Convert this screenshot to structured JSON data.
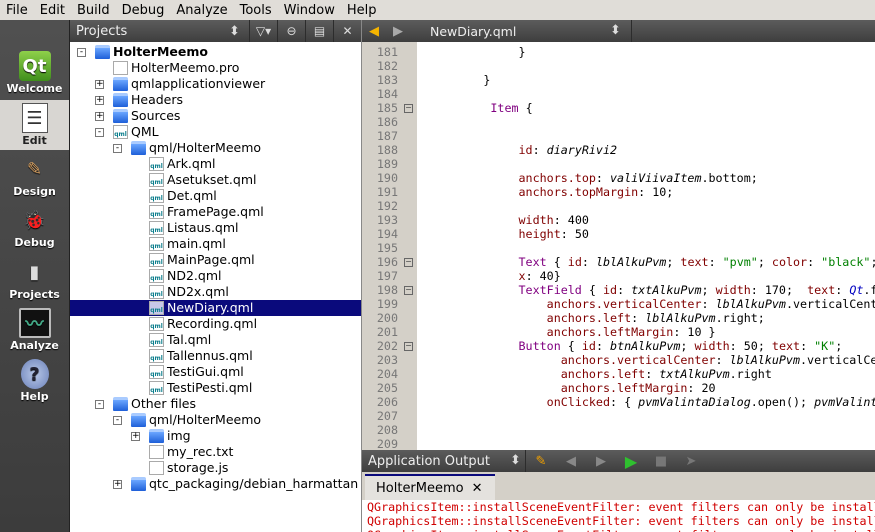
{
  "menu": [
    "File",
    "Edit",
    "Build",
    "Debug",
    "Analyze",
    "Tools",
    "Window",
    "Help"
  ],
  "modes": [
    {
      "label": "Welcome",
      "icon": "qt-logo-icon"
    },
    {
      "label": "Edit",
      "icon": "edit-document-icon",
      "active": true
    },
    {
      "label": "Design",
      "icon": "design-brush-icon"
    },
    {
      "label": "Debug",
      "icon": "debug-bug-icon"
    },
    {
      "label": "Projects",
      "icon": "projects-folder-icon"
    },
    {
      "label": "Analyze",
      "icon": "analyze-oscilloscope-icon"
    },
    {
      "label": "Help",
      "icon": "help-icon"
    }
  ],
  "projects": {
    "title": "Projects",
    "tree": [
      {
        "label": "HolterMeemo",
        "level": 0,
        "exp": "-",
        "icon": "folder-qt",
        "bold": true
      },
      {
        "label": "HolterMeemo.pro",
        "level": 1,
        "icon": "file-qt"
      },
      {
        "label": "qmlapplicationviewer",
        "level": 1,
        "exp": "+",
        "icon": "folder-qt"
      },
      {
        "label": "Headers",
        "level": 1,
        "exp": "+",
        "icon": "folder-h"
      },
      {
        "label": "Sources",
        "level": 1,
        "exp": "+",
        "icon": "folder-cpp"
      },
      {
        "label": "QML",
        "level": 1,
        "exp": "-",
        "icon": "qml"
      },
      {
        "label": "qml/HolterMeemo",
        "level": 2,
        "exp": "-",
        "icon": "folder"
      },
      {
        "label": "Ark.qml",
        "level": 3,
        "icon": "qml"
      },
      {
        "label": "Asetukset.qml",
        "level": 3,
        "icon": "qml"
      },
      {
        "label": "Det.qml",
        "level": 3,
        "icon": "qml"
      },
      {
        "label": "FramePage.qml",
        "level": 3,
        "icon": "qml"
      },
      {
        "label": "Listaus.qml",
        "level": 3,
        "icon": "qml"
      },
      {
        "label": "main.qml",
        "level": 3,
        "icon": "qml"
      },
      {
        "label": "MainPage.qml",
        "level": 3,
        "icon": "qml"
      },
      {
        "label": "ND2.qml",
        "level": 3,
        "icon": "qml"
      },
      {
        "label": "ND2x.qml",
        "level": 3,
        "icon": "qml"
      },
      {
        "label": "NewDiary.qml",
        "level": 3,
        "icon": "qml",
        "selected": true
      },
      {
        "label": "Recording.qml",
        "level": 3,
        "icon": "qml"
      },
      {
        "label": "Tal.qml",
        "level": 3,
        "icon": "qml"
      },
      {
        "label": "Tallennus.qml",
        "level": 3,
        "icon": "qml"
      },
      {
        "label": "TestiGui.qml",
        "level": 3,
        "icon": "qml"
      },
      {
        "label": "TestiPesti.qml",
        "level": 3,
        "icon": "qml"
      },
      {
        "label": "Other files",
        "level": 1,
        "exp": "-",
        "icon": "folder-files"
      },
      {
        "label": "qml/HolterMeemo",
        "level": 2,
        "exp": "-",
        "icon": "folder"
      },
      {
        "label": "img",
        "level": 3,
        "exp": "+",
        "icon": "folder"
      },
      {
        "label": "my_rec.txt",
        "level": 3,
        "icon": "file"
      },
      {
        "label": "storage.js",
        "level": 3,
        "icon": "file"
      },
      {
        "label": "qtc_packaging/debian_harmattan",
        "level": 2,
        "exp": "+",
        "icon": "folder"
      }
    ]
  },
  "editor": {
    "file": "NewDiary.qml",
    "lines": [
      {
        "n": 181,
        "t": [
          [
            "              }",
            ""
          ]
        ]
      },
      {
        "n": 182,
        "t": []
      },
      {
        "n": 183,
        "t": [
          [
            "         }",
            ""
          ]
        ]
      },
      {
        "n": 184,
        "t": []
      },
      {
        "n": 185,
        "fold": true,
        "t": [
          [
            "          ",
            ""
          ],
          [
            "Item",
            "type"
          ],
          [
            " {",
            ""
          ]
        ]
      },
      {
        "n": 186,
        "t": []
      },
      {
        "n": 187,
        "t": []
      },
      {
        "n": 188,
        "t": [
          [
            "              ",
            ""
          ],
          [
            "id",
            "prop"
          ],
          [
            ": ",
            ""
          ],
          [
            "diaryRivi2",
            "id"
          ]
        ]
      },
      {
        "n": 189,
        "t": []
      },
      {
        "n": 190,
        "t": [
          [
            "              ",
            ""
          ],
          [
            "anchors.top",
            "prop"
          ],
          [
            ": ",
            ""
          ],
          [
            "valiViivaItem",
            "id"
          ],
          [
            ".bottom;",
            ""
          ]
        ]
      },
      {
        "n": 191,
        "t": [
          [
            "              ",
            ""
          ],
          [
            "anchors.topMargin",
            "prop"
          ],
          [
            ": 10;",
            ""
          ]
        ]
      },
      {
        "n": 192,
        "t": []
      },
      {
        "n": 193,
        "t": [
          [
            "              ",
            ""
          ],
          [
            "width",
            "prop"
          ],
          [
            ": 400",
            ""
          ]
        ]
      },
      {
        "n": 194,
        "t": [
          [
            "              ",
            ""
          ],
          [
            "height",
            "prop"
          ],
          [
            ": 50",
            ""
          ]
        ]
      },
      {
        "n": 195,
        "t": []
      },
      {
        "n": 196,
        "fold": true,
        "t": [
          [
            "              ",
            ""
          ],
          [
            "Text",
            "type"
          ],
          [
            " { ",
            ""
          ],
          [
            "id",
            "prop"
          ],
          [
            ": ",
            ""
          ],
          [
            "lblAlkuPvm",
            "id"
          ],
          [
            "; ",
            ""
          ],
          [
            "text",
            "prop"
          ],
          [
            ": ",
            ""
          ],
          [
            "\"pvm\"",
            "str"
          ],
          [
            "; ",
            ""
          ],
          [
            "color",
            "prop"
          ],
          [
            ": ",
            ""
          ],
          [
            "\"black\"",
            "str"
          ],
          [
            ";",
            ""
          ]
        ]
      },
      {
        "n": 197,
        "t": [
          [
            "              ",
            ""
          ],
          [
            "x",
            "prop"
          ],
          [
            ": 40}",
            ""
          ]
        ]
      },
      {
        "n": 198,
        "fold": true,
        "t": [
          [
            "              ",
            ""
          ],
          [
            "TextField",
            "type"
          ],
          [
            " { ",
            ""
          ],
          [
            "id",
            "prop"
          ],
          [
            ": ",
            ""
          ],
          [
            "txtAlkuPvm",
            "id"
          ],
          [
            "; ",
            ""
          ],
          [
            "width",
            "prop"
          ],
          [
            ": 170;  ",
            ""
          ],
          [
            "text",
            "prop"
          ],
          [
            ": ",
            ""
          ],
          [
            "Qt",
            "qt"
          ],
          [
            ".f",
            ""
          ]
        ]
      },
      {
        "n": 199,
        "t": [
          [
            "                  ",
            ""
          ],
          [
            "anchors.verticalCenter",
            "prop"
          ],
          [
            ": ",
            ""
          ],
          [
            "lblAlkuPvm",
            "id"
          ],
          [
            ".verticalCent",
            ""
          ]
        ]
      },
      {
        "n": 200,
        "t": [
          [
            "                  ",
            ""
          ],
          [
            "anchors.left",
            "prop"
          ],
          [
            ": ",
            ""
          ],
          [
            "lblAlkuPvm",
            "id"
          ],
          [
            ".right;",
            ""
          ]
        ]
      },
      {
        "n": 201,
        "t": [
          [
            "                  ",
            ""
          ],
          [
            "anchors.leftMargin",
            "prop"
          ],
          [
            ": 10 }",
            ""
          ]
        ]
      },
      {
        "n": 202,
        "fold": true,
        "t": [
          [
            "              ",
            ""
          ],
          [
            "Button",
            "type"
          ],
          [
            " { ",
            ""
          ],
          [
            "id",
            "prop"
          ],
          [
            ": ",
            ""
          ],
          [
            "btnAlkuPvm",
            "id"
          ],
          [
            "; ",
            ""
          ],
          [
            "width",
            "prop"
          ],
          [
            ": 50; ",
            ""
          ],
          [
            "text",
            "prop"
          ],
          [
            ": ",
            ""
          ],
          [
            "\"K\"",
            "str"
          ],
          [
            ";",
            ""
          ]
        ]
      },
      {
        "n": 203,
        "t": [
          [
            "                    ",
            ""
          ],
          [
            "anchors.verticalCenter",
            "prop"
          ],
          [
            ": ",
            ""
          ],
          [
            "lblAlkuPvm",
            "id"
          ],
          [
            ".verticalCe",
            ""
          ]
        ]
      },
      {
        "n": 204,
        "t": [
          [
            "                    ",
            ""
          ],
          [
            "anchors.left",
            "prop"
          ],
          [
            ": ",
            ""
          ],
          [
            "txtAlkuPvm",
            "id"
          ],
          [
            ".right",
            ""
          ]
        ]
      },
      {
        "n": 205,
        "t": [
          [
            "                    ",
            ""
          ],
          [
            "anchors.leftMargin",
            "prop"
          ],
          [
            ": 20",
            ""
          ]
        ]
      },
      {
        "n": 206,
        "t": [
          [
            "                  ",
            ""
          ],
          [
            "onClicked",
            "prop"
          ],
          [
            ": { ",
            ""
          ],
          [
            "pvmValintaDialog",
            "id"
          ],
          [
            ".open(); ",
            ""
          ],
          [
            "pvmValint",
            "id"
          ]
        ]
      },
      {
        "n": 207,
        "t": []
      },
      {
        "n": 208,
        "t": []
      },
      {
        "n": 209,
        "t": []
      }
    ]
  },
  "output": {
    "title": "Application Output",
    "tab": "HolterMeemo",
    "lines": [
      "QGraphicsItem::installSceneEventFilter: event filters can only be install",
      "QGraphicsItem::installSceneEventFilter: event filters can only be install",
      "QGraphicsItem::installSceneEventFilter: event filters can only be install"
    ]
  }
}
